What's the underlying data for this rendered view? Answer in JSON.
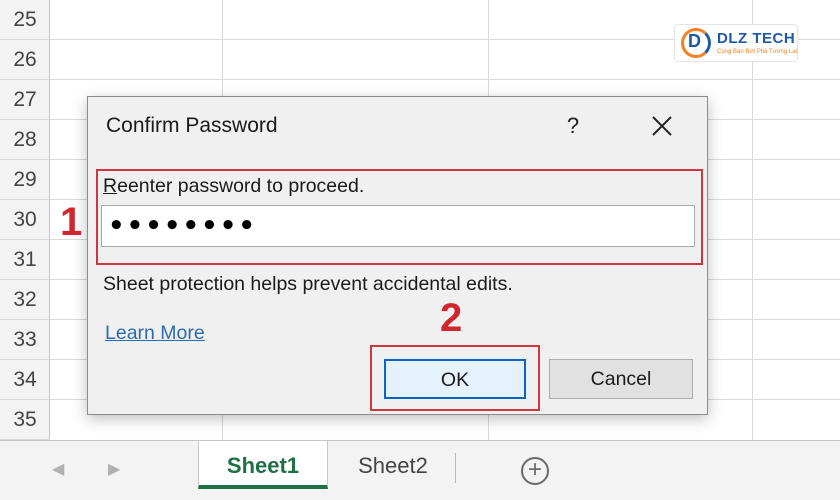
{
  "rows": [
    "25",
    "26",
    "27",
    "28",
    "29",
    "30",
    "31",
    "32",
    "33",
    "34",
    "35"
  ],
  "logo": {
    "mark": "D",
    "name": "DLZ TECH",
    "tagline": "Cùng Bạn Bứt Phá Tương Lai"
  },
  "dialog": {
    "title": "Confirm Password",
    "help_label": "?",
    "close_icon": "close-icon",
    "prompt_accesskey": "R",
    "prompt_rest": "eenter password to proceed.",
    "password_value": "••••••••",
    "info_text": "Sheet protection helps prevent accidental edits.",
    "learn_more": "Learn More",
    "ok_label": "OK",
    "cancel_label": "Cancel"
  },
  "annotations": {
    "step1": "1",
    "step2": "2",
    "highlight_color": "#d0363d"
  },
  "tabs": {
    "nav_prev": "◀",
    "nav_next": "▶",
    "sheets": [
      "Sheet1",
      "Sheet2"
    ],
    "active_sheet": "Sheet1",
    "add_label": "+"
  }
}
